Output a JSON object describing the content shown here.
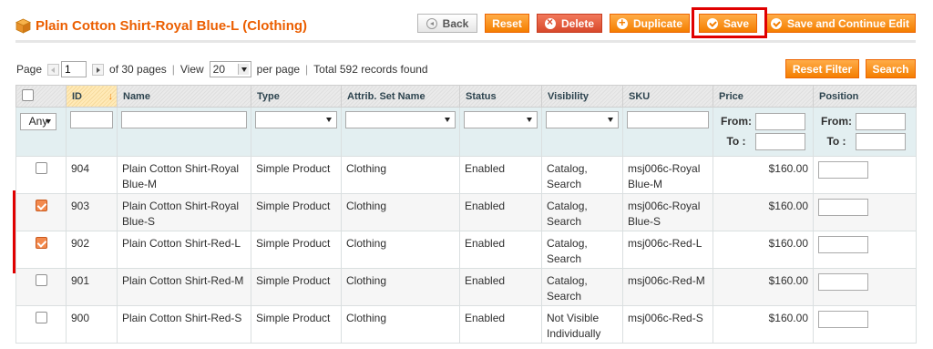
{
  "header": {
    "title": "Plain Cotton Shirt-Royal Blue-L (Clothing)",
    "buttons": {
      "back": "Back",
      "reset": "Reset",
      "delete": "Delete",
      "duplicate": "Duplicate",
      "save": "Save",
      "save_continue": "Save and Continue Edit"
    }
  },
  "pager": {
    "page_label": "Page",
    "page_value": "1",
    "of_pages": "of 30 pages",
    "view_label": "View",
    "view_value": "20",
    "per_page": "per page",
    "total": "Total 592 records found",
    "reset_filter": "Reset Filter",
    "search": "Search"
  },
  "grid": {
    "columns": [
      "ID",
      "Name",
      "Type",
      "Attrib. Set Name",
      "Status",
      "Visibility",
      "SKU",
      "Price",
      "Position"
    ],
    "filter": {
      "any_value": "Any",
      "from_label": "From:",
      "to_label": "To :"
    },
    "rows": [
      {
        "checked": false,
        "id": "904",
        "name": "Plain Cotton Shirt-Royal Blue-M",
        "type": "Simple Product",
        "set": "Clothing",
        "status": "Enabled",
        "visibility": "Catalog, Search",
        "sku": "msj006c-Royal Blue-M",
        "price": "$160.00"
      },
      {
        "checked": true,
        "id": "903",
        "name": "Plain Cotton Shirt-Royal Blue-S",
        "type": "Simple Product",
        "set": "Clothing",
        "status": "Enabled",
        "visibility": "Catalog, Search",
        "sku": "msj006c-Royal Blue-S",
        "price": "$160.00"
      },
      {
        "checked": true,
        "id": "902",
        "name": "Plain Cotton Shirt-Red-L",
        "type": "Simple Product",
        "set": "Clothing",
        "status": "Enabled",
        "visibility": "Catalog, Search",
        "sku": "msj006c-Red-L",
        "price": "$160.00"
      },
      {
        "checked": false,
        "id": "901",
        "name": "Plain Cotton Shirt-Red-M",
        "type": "Simple Product",
        "set": "Clothing",
        "status": "Enabled",
        "visibility": "Catalog, Search",
        "sku": "msj006c-Red-M",
        "price": "$160.00"
      },
      {
        "checked": false,
        "id": "900",
        "name": "Plain Cotton Shirt-Red-S",
        "type": "Simple Product",
        "set": "Clothing",
        "status": "Enabled",
        "visibility": "Not Visible Individually",
        "sku": "msj006c-Red-S",
        "price": "$160.00"
      }
    ]
  },
  "colors": {
    "accent": "#eb5e00",
    "button": "#f47e00",
    "delete": "#d8492b",
    "highlight_box": "#e00000"
  }
}
